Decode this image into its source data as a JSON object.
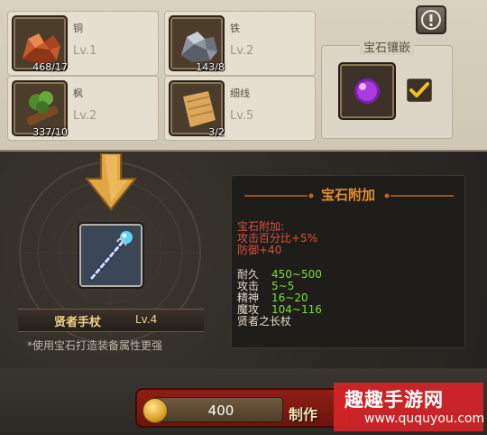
{
  "materials": [
    {
      "name": "铜",
      "count": "468/17",
      "level": "Lv.1",
      "icon": "copper-ore-icon"
    },
    {
      "name": "铁",
      "count": "143/8",
      "level": "Lv.2",
      "icon": "iron-ore-icon"
    },
    {
      "name": "枫",
      "count": "337/10",
      "level": "Lv.2",
      "icon": "maple-wood-icon"
    },
    {
      "name": "细线",
      "count": "3/2",
      "level": "Lv.5",
      "icon": "fine-thread-icon"
    }
  ],
  "gem": {
    "title": "宝石镶嵌",
    "icon": "purple-gem-icon",
    "checked": true
  },
  "item": {
    "name": "贤者手杖",
    "level": "Lv.4",
    "icon": "sage-staff-icon",
    "hint": "*使用宝石打造装备属性更强"
  },
  "detail": {
    "title": "宝石附加",
    "bonus_lines": [
      "宝石附加:",
      "攻击百分比+5%",
      "防御+40"
    ],
    "stats": [
      {
        "label": "耐久",
        "value": "450~500"
      },
      {
        "label": "攻击",
        "value": "5~5"
      },
      {
        "label": "精神",
        "value": "16~20"
      },
      {
        "label": "魔攻",
        "value": "104~116"
      }
    ],
    "footer": "贤者之长杖"
  },
  "craft": {
    "price": "400",
    "label": "制作",
    "currency_icon": "gold-coin-icon"
  },
  "watermark": {
    "text": "趣趣手游网",
    "url": "www.ququyou.com"
  },
  "colors": {
    "accent_orange": "#e58d2c",
    "bonus_red": "#d8503f",
    "stat_green": "#7fdc3a",
    "craft_red": "#8f1f15"
  }
}
